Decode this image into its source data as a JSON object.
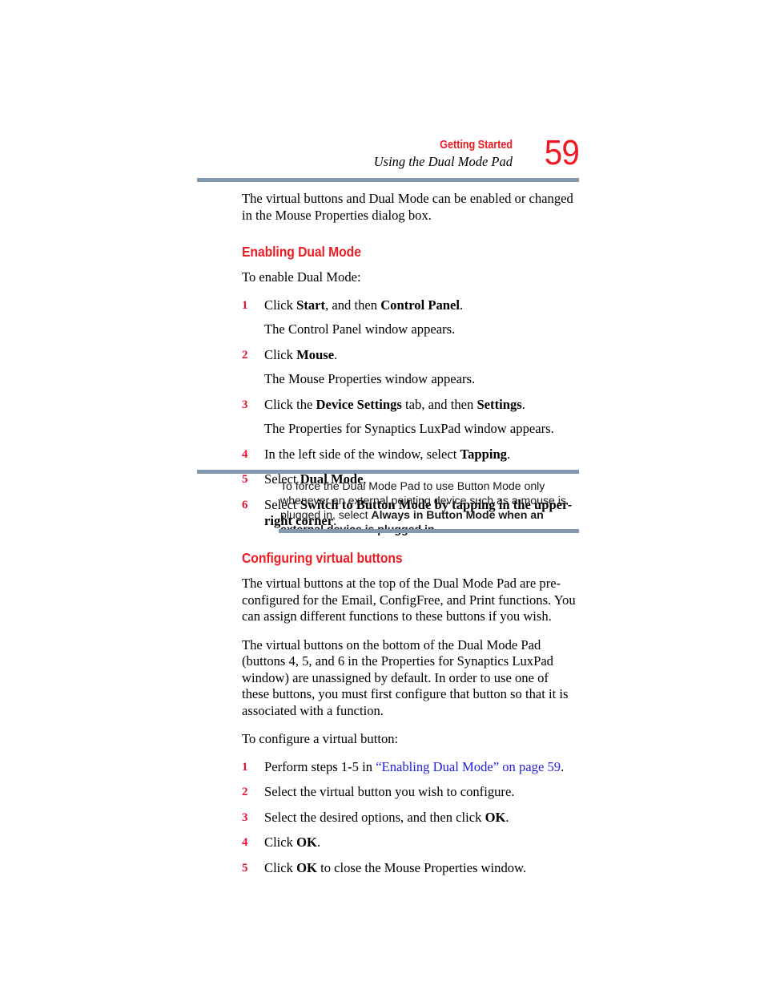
{
  "header": {
    "chapter": "Getting Started",
    "section": "Using the Dual Mode Pad",
    "page_number": "59"
  },
  "colors": {
    "heading_red": "#ED1C24",
    "step_number_red": "#E8112D",
    "rule_slate": "#8399B0",
    "link_blue": "#2222DD"
  },
  "intro": {
    "paragraph": "The virtual buttons and Dual Mode can be enabled or changed in the Mouse Properties dialog box."
  },
  "enabling": {
    "heading": "Enabling Dual Mode",
    "lead_in": "To enable Dual Mode:",
    "steps": [
      {
        "num": "1",
        "parts": [
          {
            "text": "Click ",
            "bold": false
          },
          {
            "text": "Start",
            "bold": true
          },
          {
            "text": ", and then ",
            "bold": false
          },
          {
            "text": "Control Panel",
            "bold": true
          },
          {
            "text": ".",
            "bold": false
          }
        ],
        "result": "The Control Panel window appears."
      },
      {
        "num": "2",
        "parts": [
          {
            "text": "Click ",
            "bold": false
          },
          {
            "text": "Mouse",
            "bold": true
          },
          {
            "text": ".",
            "bold": false
          }
        ],
        "result": "The Mouse Properties window appears."
      },
      {
        "num": "3",
        "parts": [
          {
            "text": "Click the ",
            "bold": false
          },
          {
            "text": "Device Settings",
            "bold": true
          },
          {
            "text": " tab, and then ",
            "bold": false
          },
          {
            "text": "Settings",
            "bold": true
          },
          {
            "text": ".",
            "bold": false
          }
        ],
        "result": "The Properties for Synaptics LuxPad window appears."
      },
      {
        "num": "4",
        "parts": [
          {
            "text": "In the left side of the window, select ",
            "bold": false
          },
          {
            "text": "Tapping",
            "bold": true
          },
          {
            "text": ".",
            "bold": false
          }
        ],
        "result": ""
      },
      {
        "num": "5",
        "parts": [
          {
            "text": "Select ",
            "bold": false
          },
          {
            "text": "Dual Mode",
            "bold": true
          },
          {
            "text": ".",
            "bold": false
          }
        ],
        "result": ""
      },
      {
        "num": "6",
        "parts": [
          {
            "text": "Select ",
            "bold": false
          },
          {
            "text": "Switch to Button Mode by tapping in the upper-right corner",
            "bold": true
          },
          {
            "text": ".",
            "bold": false
          }
        ],
        "result": ""
      }
    ]
  },
  "note": {
    "parts": [
      {
        "text": "To force the Dual Mode Pad to use Button Mode only whenever an external pointing device such as a mouse is plugged in, select ",
        "bold": false
      },
      {
        "text": "Always in Button Mode when an external device is plugged in",
        "bold": true
      },
      {
        "text": ".",
        "bold": false
      }
    ]
  },
  "configuring": {
    "heading": "Configuring virtual buttons",
    "paragraph_1": "The virtual buttons at the top of the Dual Mode Pad are pre-configured for the Email, ConfigFree, and Print functions. You can assign different functions to these buttons if you wish.",
    "paragraph_2": "The virtual buttons on the bottom of the Dual Mode Pad (buttons 4, 5, and 6 in the Properties for Synaptics LuxPad window) are unassigned by default. In order to use one of these buttons, you must first configure that button so that it is associated with a function.",
    "lead_in": "To configure a virtual button:",
    "steps": [
      {
        "num": "1",
        "parts": [
          {
            "text": "Perform steps 1-5 in ",
            "bold": false
          },
          {
            "text": "“Enabling Dual Mode” on page 59",
            "bold": false,
            "link": true
          },
          {
            "text": ".",
            "bold": false
          }
        ]
      },
      {
        "num": "2",
        "parts": [
          {
            "text": "Select the virtual button you wish to configure.",
            "bold": false
          }
        ]
      },
      {
        "num": "3",
        "parts": [
          {
            "text": "Select the desired options, and then click ",
            "bold": false
          },
          {
            "text": "OK",
            "bold": true
          },
          {
            "text": ".",
            "bold": false
          }
        ]
      },
      {
        "num": "4",
        "parts": [
          {
            "text": "Click ",
            "bold": false
          },
          {
            "text": "OK",
            "bold": true
          },
          {
            "text": ".",
            "bold": false
          }
        ]
      },
      {
        "num": "5",
        "parts": [
          {
            "text": "Click ",
            "bold": false
          },
          {
            "text": "OK",
            "bold": true
          },
          {
            "text": " to close the Mouse Properties window.",
            "bold": false
          }
        ]
      }
    ]
  }
}
